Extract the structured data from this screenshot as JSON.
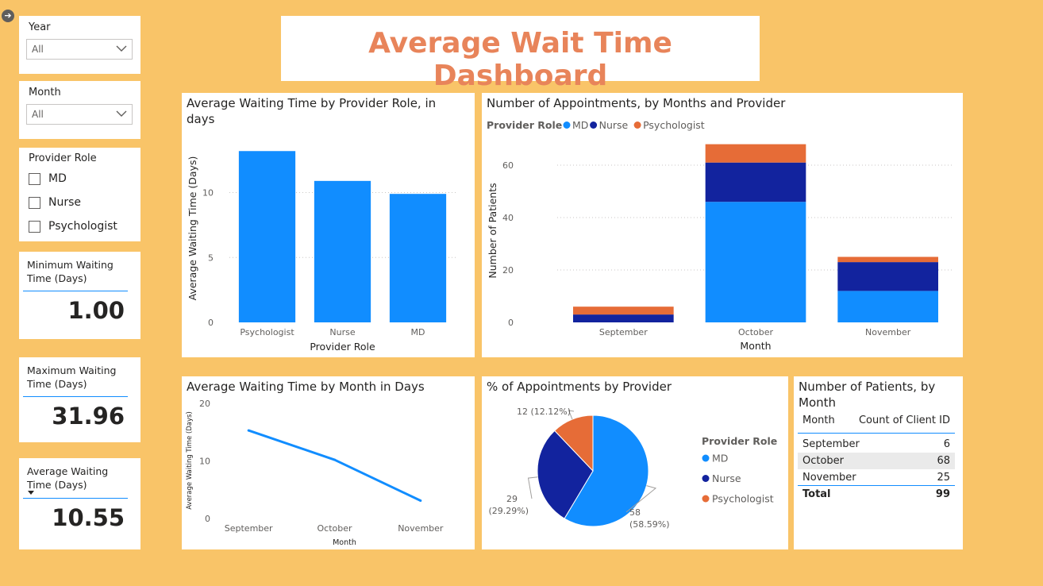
{
  "title": "Average Wait Time Dashboard",
  "nav": {
    "back_glyph": "➔"
  },
  "slicers": {
    "year": {
      "label": "Year",
      "value": "All"
    },
    "month": {
      "label": "Month",
      "value": "All"
    },
    "provider_role": {
      "label": "Provider Role",
      "options": [
        "MD",
        "Nurse",
        "Psychologist"
      ]
    }
  },
  "kpis": {
    "min": {
      "label": "Minimum Waiting Time (Days)",
      "value": "1.00"
    },
    "max": {
      "label": "Maximum Waiting Time (Days)",
      "value": "31.96"
    },
    "avg": {
      "label": "Average Waiting Time (Days)",
      "value": "10.55"
    }
  },
  "charts": {
    "role_bar": {
      "title": "Average Waiting Time by Provider Role, in days"
    },
    "month_stack": {
      "title": "Number of Appointments, by Months and Provider",
      "legend_title": "Provider Role"
    },
    "month_line": {
      "title": "Average Waiting Time by Month in Days"
    },
    "pie": {
      "title": "% of Appointments by Provider",
      "legend_title": "Provider Role"
    },
    "patients_table": {
      "title": "Number of Patients, by Month"
    }
  },
  "colors": {
    "md": "#118DFF",
    "nurse": "#12239E",
    "psychologist": "#E66C37",
    "title": "#E8845A"
  },
  "chart_data": [
    {
      "type": "bar",
      "title": "Average Waiting Time by Provider Role, in days",
      "categories": [
        "Psychologist",
        "Nurse",
        "MD"
      ],
      "values": [
        13.2,
        10.9,
        9.9
      ],
      "xlabel": "Provider Role",
      "ylabel": "Average Waiting Time (Days)",
      "ylim": [
        0,
        14.5
      ],
      "yticks": [
        0,
        5,
        10
      ],
      "grid": true
    },
    {
      "type": "bar",
      "stacked": true,
      "title": "Number of Appointments, by Months and Provider",
      "categories": [
        "September",
        "October",
        "November"
      ],
      "series": [
        {
          "name": "MD",
          "values": [
            0,
            46,
            12
          ]
        },
        {
          "name": "Nurse",
          "values": [
            3,
            15,
            11
          ]
        },
        {
          "name": "Psychologist",
          "values": [
            3,
            7,
            2
          ]
        }
      ],
      "xlabel": "Month",
      "ylabel": "Number of Patients",
      "ylim": [
        0,
        70
      ],
      "yticks": [
        0,
        20,
        40,
        60
      ],
      "legend": "top-left",
      "grid": true
    },
    {
      "type": "line",
      "title": "Average Waiting Time by Month in Days",
      "x": [
        "September",
        "October",
        "November"
      ],
      "values": [
        15.3,
        10.2,
        3.1
      ],
      "xlabel": "Month",
      "ylabel": "Average Waiting Time (Days)",
      "ylim": [
        0,
        20
      ],
      "yticks": [
        0,
        10,
        20
      ]
    },
    {
      "type": "pie",
      "title": "% of Appointments by Provider",
      "categories": [
        "MD",
        "Nurse",
        "Psychologist"
      ],
      "values": [
        58,
        29,
        12
      ],
      "labels": [
        "58 (58.59%)",
        "29 (29.29%)",
        "12 (12.12%)"
      ],
      "legend": "right"
    },
    {
      "type": "table",
      "title": "Number of Patients, by Month",
      "columns": [
        "Month",
        "Count of Client ID"
      ],
      "rows": [
        [
          "September",
          "6"
        ],
        [
          "October",
          "68"
        ],
        [
          "November",
          "25"
        ]
      ],
      "total": [
        "Total",
        "99"
      ]
    }
  ]
}
